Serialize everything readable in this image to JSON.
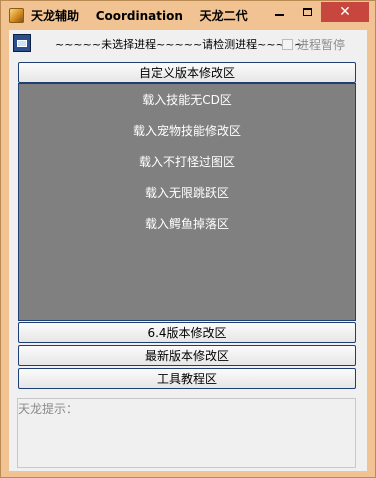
{
  "window": {
    "title": "天龙辅助    Coordination    天龙二代",
    "controls": {
      "minimize": "minimize",
      "maximize": "maximize",
      "close": "✕"
    }
  },
  "toolbar": {
    "status_text": "~~~~~未选择进程~~~~~请检测进程~~~~~",
    "pause_label": "进程暂停",
    "pause_checked": false
  },
  "buttons": {
    "custom_version": "自定义版本修改区",
    "v64": "6.4版本修改区",
    "latest": "最新版本修改区",
    "tutorial": "工具教程区"
  },
  "panel": {
    "items": [
      "载入技能无CD区",
      "载入宠物技能修改区",
      "载入不打怪过图区",
      "载入无限跳跃区",
      "载入鳄鱼掉落区"
    ]
  },
  "hint": {
    "label": "天龙提示：",
    "value": ""
  }
}
